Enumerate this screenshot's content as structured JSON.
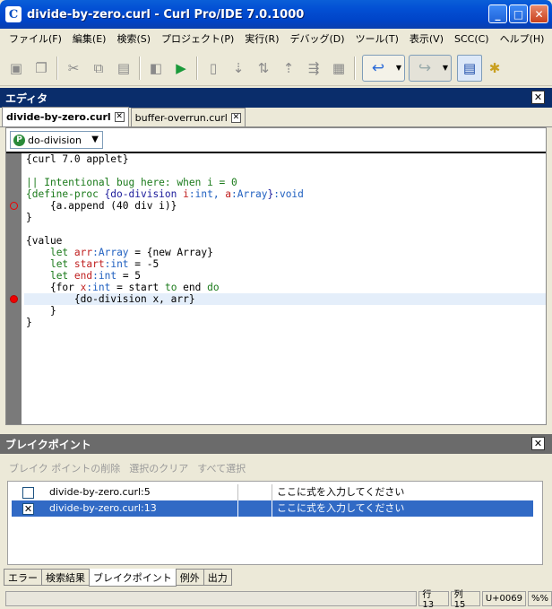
{
  "window": {
    "title": "divide-by-zero.curl - Curl Pro/IDE 7.0.1000",
    "app_icon": "curl-logo",
    "min": "_",
    "max": "□",
    "close": "✕"
  },
  "menu": [
    "ファイル(F)",
    "編集(E)",
    "検索(S)",
    "プロジェクト(P)",
    "実行(R)",
    "デバッグ(D)",
    "ツール(T)",
    "表示(V)",
    "SCC(C)",
    "ヘルプ(H)"
  ],
  "editor_panel": {
    "title": "エディタ",
    "tabs": [
      {
        "label": "divide-by-zero.curl",
        "active": true
      },
      {
        "label": "buffer-overrun.curl",
        "active": false
      }
    ],
    "proc_select": {
      "value": "do-division",
      "icon": "P"
    }
  },
  "code": {
    "lines": [
      "{curl 7.0 applet}",
      "",
      "|| Intentional bug here: when i = 0",
      "{define-proc {do-division i:int, a:Array}:void",
      "    {a.append (40 div i)}",
      "}",
      "",
      "{value",
      "    let arr:Array = {new Array}",
      "    let start:int = -5",
      "    let end:int = 5",
      "    {for x:int = start to end do",
      "        {do-division x, arr}",
      "    }",
      "}"
    ]
  },
  "breakpoints_panel": {
    "title": "ブレイクポイント",
    "actions": [
      "ブレイク ポイントの削除",
      "選択のクリア",
      "すべて選択"
    ],
    "rows": [
      {
        "file": "divide-by-zero.curl:5",
        "condition": "ここに式を入力してください",
        "checked": false,
        "selected": false
      },
      {
        "file": "divide-by-zero.curl:13",
        "condition": "ここに式を入力してください",
        "checked": true,
        "selected": true
      }
    ]
  },
  "bottom_tabs": [
    "エラー",
    "検索結果",
    "ブレイクポイント",
    "例外",
    "出力"
  ],
  "status": {
    "line": "行 13",
    "col": "列 15",
    "char": "U+0069",
    "extra": "%%"
  }
}
